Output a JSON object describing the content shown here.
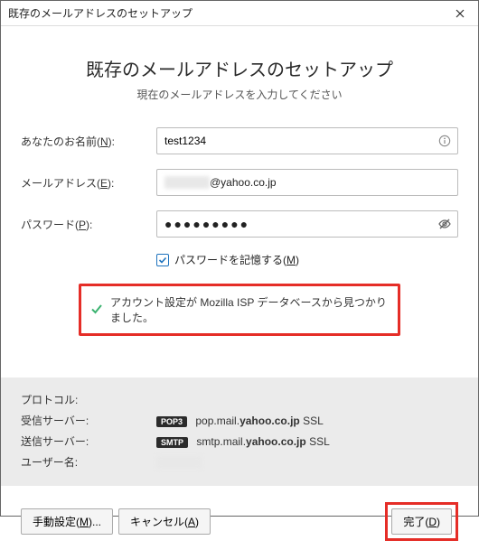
{
  "window": {
    "title": "既存のメールアドレスのセットアップ"
  },
  "header": {
    "heading": "既存のメールアドレスのセットアップ",
    "subheading": "現在のメールアドレスを入力してください"
  },
  "fields": {
    "name": {
      "label": "あなたのお名前(",
      "mnemonic": "N",
      "label_after": "):",
      "value": "test1234"
    },
    "email": {
      "label": "メールアドレス(",
      "mnemonic": "E",
      "label_after": "):",
      "masked": "xxxxxxx",
      "domain": "@yahoo.co.jp"
    },
    "password": {
      "label": "パスワード(",
      "mnemonic": "P",
      "label_after": "):",
      "dots": "●●●●●●●●●"
    },
    "remember": {
      "label": "パスワードを記憶する(",
      "mnemonic": "M",
      "label_after": ")",
      "checked": true
    }
  },
  "status": {
    "text": "アカウント設定が Mozilla ISP データベースから見つかりました。"
  },
  "server": {
    "protocol_label": "プロトコル:",
    "incoming_label": "受信サーバー:",
    "incoming_badge": "POP3",
    "incoming_pre": "pop.mail.",
    "incoming_bold": "yahoo.co.jp",
    "incoming_post": " SSL",
    "outgoing_label": "送信サーバー:",
    "outgoing_badge": "SMTP",
    "outgoing_pre": "smtp.mail.",
    "outgoing_bold": "yahoo.co.jp",
    "outgoing_post": " SSL",
    "username_label": "ユーザー名:",
    "username_value": "xxxxxxx"
  },
  "buttons": {
    "manual": {
      "label": "手動設定(",
      "mnemonic": "M",
      "label_after": ")..."
    },
    "cancel": {
      "label": "キャンセル(",
      "mnemonic": "A",
      "label_after": ")"
    },
    "done": {
      "label": "完了(",
      "mnemonic": "D",
      "label_after": ")"
    }
  }
}
